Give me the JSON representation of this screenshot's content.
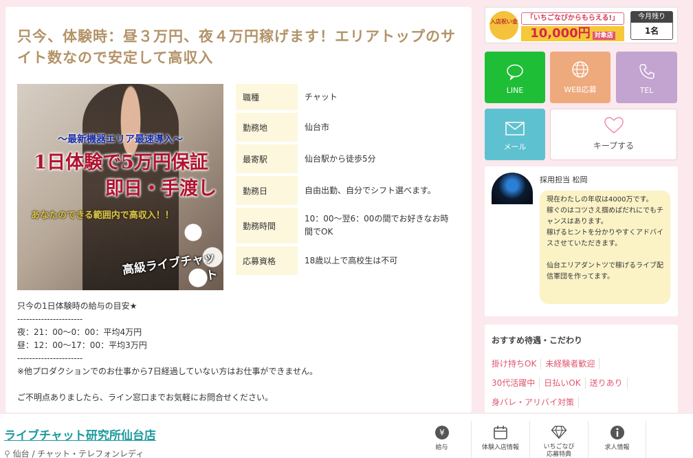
{
  "job": {
    "title": "只今、体験時：昼３万円、夜４万円稼げます！エリアトップのサイト数なので安定して高収入",
    "hero": {
      "sub": "～最新機器エリア最速導入～",
      "line1": "1日体験で5万円保証",
      "line2": "即日・手渡し",
      "line3": "あなたのできる範囲内で高収入！！",
      "line4": "高級ライブチャット"
    },
    "info": [
      {
        "label": "職種",
        "value": "チャット"
      },
      {
        "label": "勤務地",
        "value": "仙台市"
      },
      {
        "label": "最寄駅",
        "value": "仙台駅から徒歩5分"
      },
      {
        "label": "勤務日",
        "value": "自由出勤、自分でシフト選べます。"
      },
      {
        "label": "勤務時間",
        "value": "10：00～翌6：00の間でお好きなお時間でOK"
      },
      {
        "label": "応募資格",
        "value": "18歳以上で高校生は不可"
      }
    ],
    "description": "只今の1日体験時の給与の目安★\n----------------------\n夜：21：00～0：00：平均4万円\n昼：12：00～17：00：平均3万円\n----------------------\n※他プロダクションでのお仕事から7日経過していない方はお仕事ができません。\n\nご不明点ありましたら、ライン窓口までお気軽にお問合せください。"
  },
  "banner": {
    "badge": "入店祝い金",
    "promo1": "「いちごなびからもらえる!」",
    "promo2": "10,000円",
    "promo2_suffix": "対象店",
    "month_label": "今月残り",
    "month_value": "1名"
  },
  "actions": {
    "line": "LINE",
    "web": "WEB応募",
    "tel": "TEL",
    "mail": "メール",
    "keep": "キープする"
  },
  "recruiter": {
    "name": "採用担当 松岡",
    "message": "現在わたしの年収は4000万です。\n稼ぐのはコツさえ掴めばだれにでもチャンスはあります。\n稼げるヒントを分かりやすくアドバイスさせていただきます。\n\n仙台エリアダントツで稼げるライブ配信軍団を作ってます。"
  },
  "features": {
    "title": "おすすめ待遇・こだわり",
    "rows": [
      [
        "掛け持ちOK",
        "未経験者歓迎"
      ],
      [
        "30代活躍中",
        "日払いOK",
        "送りあり"
      ],
      [
        "身バレ・アリバイ対策"
      ]
    ]
  },
  "shop": {
    "name": "ライブチャット研究所仙台店",
    "sub": "仙台 / チャット・テレフォンレディ"
  },
  "nav": {
    "pay": "給与",
    "trial": "体験入店情報",
    "perk_line1": "いちごなび",
    "perk_line2": "応募特典",
    "recruit": "求人情報"
  },
  "colors": {
    "accent_title": "#b39368",
    "line_green": "#1fbe37",
    "web_orange": "#eea97d",
    "tel_purple": "#c3a3cf",
    "mail_blue": "#5ec1d0",
    "tag_pink": "#e0566f",
    "shop_teal": "#1c9a9e"
  }
}
